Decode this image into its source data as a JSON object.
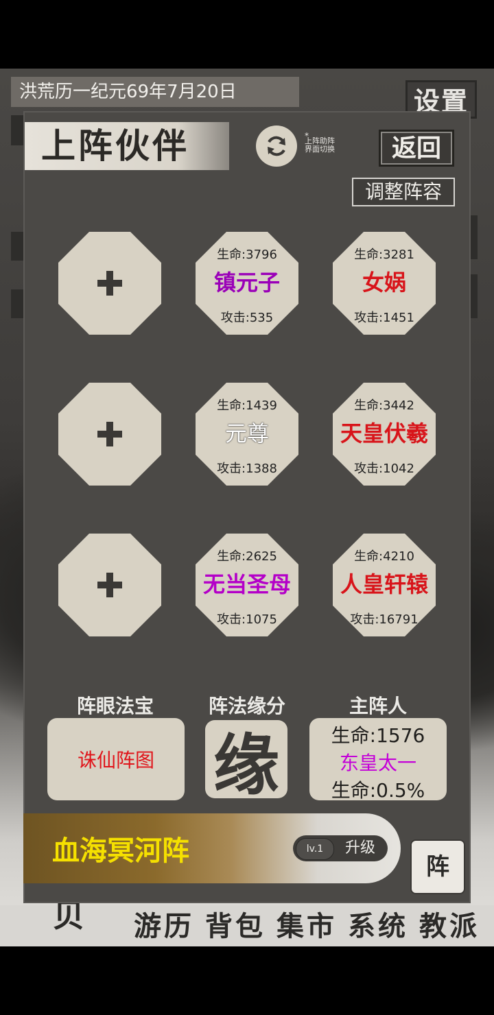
{
  "background": {
    "date": "洪荒历一纪元69年7月20日",
    "settings_label": "设置",
    "nav": [
      "游",
      "历",
      "背",
      "包",
      "集",
      "市",
      "系",
      "统",
      "教",
      "派"
    ],
    "emblem_char": "贝"
  },
  "dialog": {
    "title": "上阵伙伴",
    "refresh_note_star": "*",
    "refresh_note_line1": "上阵助阵",
    "refresh_note_line2": "界面切换",
    "back_label": "返回",
    "adjust_label": "调整阵容"
  },
  "companions": [
    {
      "empty": true
    },
    {
      "hp": "生命:3796",
      "name": "镇元子",
      "atk": "攻击:535",
      "color": "#9a00b8"
    },
    {
      "hp": "生命:3281",
      "name": "女娲",
      "atk": "攻击:1451",
      "color": "#d8141a"
    },
    {
      "empty": true
    },
    {
      "hp": "生命:1439",
      "name": "元尊",
      "atk": "攻击:1388",
      "color": "#ffffff"
    },
    {
      "hp": "生命:3442",
      "name": "天皇伏羲",
      "atk": "攻击:1042",
      "color": "#d8141a"
    },
    {
      "empty": true
    },
    {
      "hp": "生命:2625",
      "name": "无当圣母",
      "atk": "攻击:1075",
      "color": "#b400c8"
    },
    {
      "hp": "生命:4210",
      "name": "人皇轩辕",
      "atk": "攻击:16791",
      "color": "#d8141a"
    }
  ],
  "sections": {
    "treasure_label": "阵眼法宝",
    "treasure_name": "诛仙阵图",
    "fate_label": "阵法缘分",
    "fate_glyph": "缘",
    "main_label": "主阵人",
    "main_hp": "生命:1576",
    "main_name": "东皇太一",
    "main_bonus": "生命:0.5%"
  },
  "formation": {
    "name": "血海冥河阵",
    "level": "lv.1",
    "upgrade_label": "升级",
    "side_button": "阵"
  }
}
